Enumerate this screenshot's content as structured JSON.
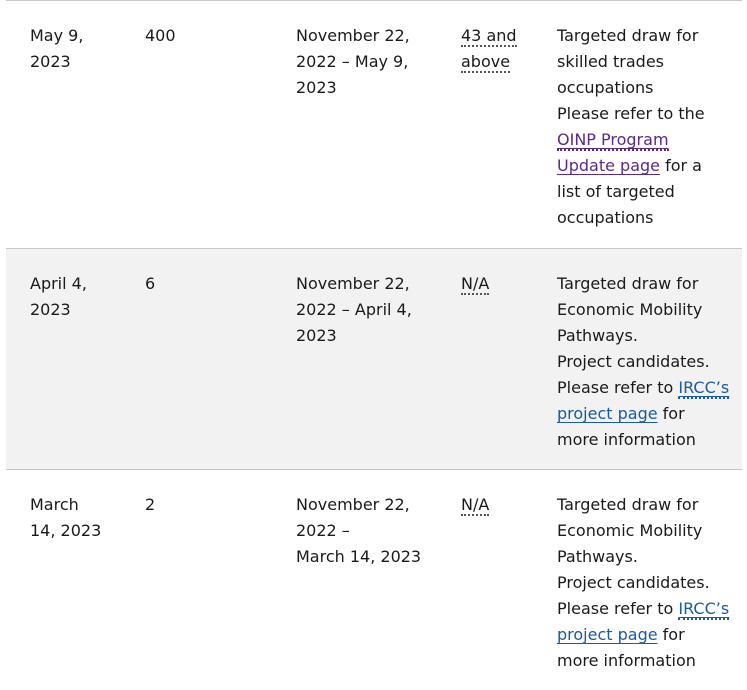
{
  "rows": [
    {
      "date_line1": "May 9,",
      "date_line2": "2023",
      "invitations": "400",
      "range_line1": "November 22,",
      "range_line2": "2022 – May 9,",
      "range_line3": "2023",
      "score_line1": "43 and",
      "score_line2": "above",
      "notes_line1": "Targeted draw for",
      "notes_line2": "skilled trades",
      "notes_line3": "occupations",
      "notes_line4": "Please refer to the",
      "link_line1": "OINP Program",
      "link_line2": "Update page",
      "after_link": " for a",
      "notes_line5": "list of targeted",
      "notes_line6": "occupations"
    },
    {
      "date_line1": "April 4,",
      "date_line2": "2023",
      "invitations": "6",
      "range_line1": "November 22,",
      "range_line2": "2022 – April 4,",
      "range_line3": "2023",
      "score": "N/A",
      "notes_line1": "Targeted draw for",
      "notes_line2": "Economic Mobility",
      "notes_line3": "Pathways.",
      "notes_line4": "Project candidates.",
      "before_link": "Please refer to ",
      "link_part1": "IRCC’s",
      "link_part2": "project page",
      "after_link": " for",
      "notes_line5": "more information"
    },
    {
      "date_line1": "March",
      "date_line2": "14, 2023",
      "invitations": "2",
      "range_line1": "November 22,",
      "range_line2": "2022 –",
      "range_line3": "March 14, 2023",
      "score": "N/A",
      "notes_line1": "Targeted draw for",
      "notes_line2": "Economic Mobility",
      "notes_line3": "Pathways.",
      "notes_line4": "Project candidates.",
      "before_link": "Please refer to ",
      "link_part1": "IRCC’s",
      "link_part2": "project page",
      "after_link": " for",
      "notes_line5": "more information"
    }
  ]
}
